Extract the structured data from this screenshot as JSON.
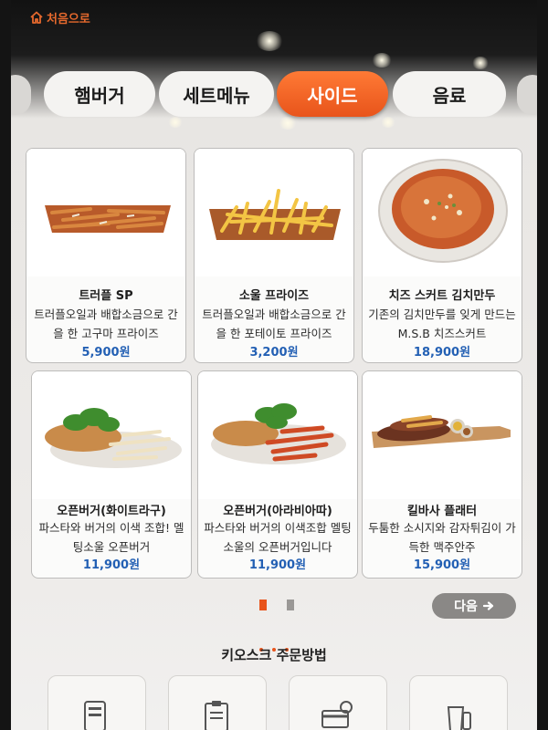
{
  "header": {
    "home_label": "처음으로",
    "home_icon": "home-icon",
    "accent_color": "#e8541b"
  },
  "tabs": [
    {
      "label": "햄버거",
      "active": false
    },
    {
      "label": "세트메뉴",
      "active": false
    },
    {
      "label": "사이드",
      "active": true
    },
    {
      "label": "음료",
      "active": false
    }
  ],
  "menu_items": [
    {
      "name": "트러플 SP",
      "desc": "트러플오일과 배합소금으로 간을 한 고구마 프라이즈",
      "price": "5,900원"
    },
    {
      "name": "소울 프라이즈",
      "desc": "트러플오일과 배합소금으로 간을 한 포테이토 프라이즈",
      "price": "3,200원"
    },
    {
      "name": "치즈 스커트 김치만두",
      "desc": "기존의 김치만두를 잊게 만드는 M.S.B 치즈스커트",
      "price": "18,900원"
    },
    {
      "name": "오픈버거(화이트라구)",
      "desc": "파스타와 버거의 이색 조합! 멜팅소울 오픈버거",
      "price": "11,900원"
    },
    {
      "name": "오픈버거(아라비아따)",
      "desc": "파스타와 버거의 이색조합 멜팅소울의 오픈버거입니다",
      "price": "11,900원"
    },
    {
      "name": "킬바사 플래터",
      "desc": "두툼한 소시지와 감자튀김이 가득한 맥주안주",
      "price": "15,900원"
    }
  ],
  "pager": {
    "current_page": 1,
    "total_pages": 2,
    "next_label": "다음",
    "next_icon": "arrow-right-icon"
  },
  "guide": {
    "title": "키오스크 주문방법",
    "icons": [
      "kiosk-screen-icon",
      "menu-board-icon",
      "card-payment-icon",
      "drink-cup-icon"
    ]
  }
}
